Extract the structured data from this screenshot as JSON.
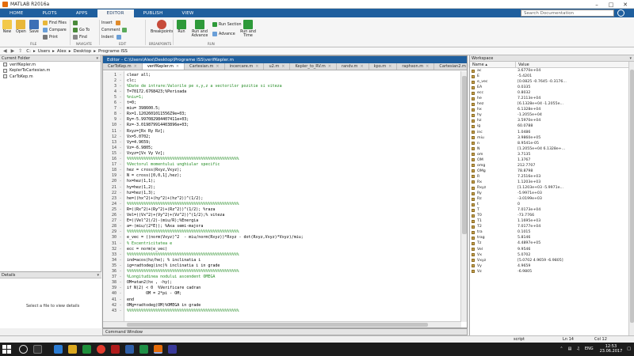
{
  "window": {
    "title": "MATLAB R2016a"
  },
  "ribbon_tabs": [
    "HOME",
    "PLOTS",
    "APPS",
    "EDITOR",
    "PUBLISH",
    "VIEW"
  ],
  "active_ribbon_tab": "EDITOR",
  "search": {
    "placeholder": "Search Documentation"
  },
  "ribbon": {
    "new": "New",
    "open": "Open",
    "save": "Save",
    "find_files": "Find Files",
    "compare": "Compare",
    "print": "Print",
    "go_to": "Go To",
    "find": "Find",
    "insert": "Insert",
    "comment": "Comment",
    "indent": "Indent",
    "breakpoints": "Breakpoints",
    "run": "Run",
    "run_and_advance": "Run and Advance",
    "run_section": "Run Section",
    "advance": "Advance",
    "run_and_time": "Run and Time",
    "groups": {
      "file": "FILE",
      "navigate": "NAVIGATE",
      "edit": "EDIT",
      "breakpoints": "BREAKPOINTS",
      "run": "RUN"
    }
  },
  "path": [
    "C:",
    "Users",
    "Alex",
    "Desktop",
    "Programe ISS"
  ],
  "current_folder": {
    "title": "Current Folder",
    "files": [
      "verifKepler.m",
      "KeplerToCartesian.m",
      "CarToKep.m"
    ]
  },
  "details": {
    "title": "Details",
    "message": "Select a file to view details"
  },
  "editor": {
    "title": "Editor - C:\\Users\\Alex\\Desktop\\Programe ISS\\verifKepler.m",
    "tabs": [
      "CarToKep.m",
      "verifKepler.m",
      "Cartesian.m",
      "incercare.m",
      "u2.m",
      "Kepler_to_RV.m",
      "randv.m",
      "kpo.m",
      "raphson.m",
      "Cartesian2.m",
      "sqrt.m"
    ],
    "active_tab": "verifKepler.m",
    "lines": [
      {
        "n": "1",
        "c": "clear all;",
        "t": "code"
      },
      {
        "n": "2",
        "c": "clc;",
        "t": "code"
      },
      {
        "n": "3",
        "c": "%Date de intrare:Valorile pe x,y,z a vectorilor pozitie si viteza",
        "t": "comment"
      },
      {
        "n": "4",
        "c": "T=70172.6768423;%Perioada",
        "t": "code"
      },
      {
        "n": "5",
        "c": "%niu=1;",
        "t": "comment"
      },
      {
        "n": "6",
        "c": "t=0;",
        "t": "code"
      },
      {
        "n": "7",
        "c": "miu= 398600.5;",
        "t": "code"
      },
      {
        "n": "8",
        "c": "Rx=1.1202601011556Z9e+03;",
        "t": "code"
      },
      {
        "n": "9",
        "c": "Ry=-5.997082984407411e+03;",
        "t": "code"
      },
      {
        "n": "10",
        "c": "Rz=-3.019879914403896e+03;",
        "t": "code"
      },
      {
        "n": "11",
        "c": "Rxyz=[Rx Ry Rz];",
        "t": "code"
      },
      {
        "n": "12",
        "c": "Vx=5.0702;",
        "t": "code"
      },
      {
        "n": "13",
        "c": "Vy=4.9659;",
        "t": "code"
      },
      {
        "n": "14",
        "c": "Vz=-6.9805;",
        "t": "code"
      },
      {
        "n": "15",
        "c": "Vxyz=[Vx Vy Vz];",
        "t": "code"
      },
      {
        "n": "16",
        "c": "%%%%%%%%%%%%%%%%%%%%%%%%%%%%%%%%%%%%%%%%%%%%%%%",
        "t": "comment"
      },
      {
        "n": "17",
        "c": "%Vectorul momentului unghiular specific",
        "t": "comment"
      },
      {
        "n": "18",
        "c": "hez = cross(Rxyz,Vxyz);",
        "t": "code"
      },
      {
        "n": "19",
        "c": "N = cross([0,0,1],hez);",
        "t": "code"
      },
      {
        "n": "20",
        "c": "hx=hez(1,1);",
        "t": "code"
      },
      {
        "n": "21",
        "c": "hy=hez(1,2);",
        "t": "code"
      },
      {
        "n": "22",
        "c": "hz=hez(1,3);",
        "t": "code"
      },
      {
        "n": "23",
        "c": "he=((hx^2)+(hy^2)+(hz^2))^(1/2);",
        "t": "code"
      },
      {
        "n": "24",
        "c": "%%%%%%%%%%%%%%%%%%%%%%%%%%%%%%%%%%%%%%%%%%%%%%%",
        "t": "comment"
      },
      {
        "n": "25",
        "c": "R=((Rx^2)+(Ry^2)+(Rz^2))^(1/2); %raza",
        "t": "code"
      },
      {
        "n": "26",
        "c": "Vel=((Vx^2)+(Vy^2)+(Vz^2))^(1/2);% viteza",
        "t": "code"
      },
      {
        "n": "27",
        "c": "E=((Vel^2)/2)-(miu/R);%Energia",
        "t": "code"
      },
      {
        "n": "28",
        "c": "a=-(miu/(2*E)); %Axa semi-majora",
        "t": "code"
      },
      {
        "n": "29",
        "c": "%%%%%%%%%%%%%%%%%%%%%%%%%%%%%%%%%%%%%%%%%%%%%%%",
        "t": "comment"
      },
      {
        "n": "30",
        "c": "e_vec = ((norm(Vxyz)^2  - miu/norm(Rxyz))*Rxyz - dot(Rxyz,Vxyz)*Vxyz)/miu;",
        "t": "code"
      },
      {
        "n": "31",
        "c": "% Excentricitatea e",
        "t": "comment"
      },
      {
        "n": "32",
        "c": "ecc = norm(e_vec)",
        "t": "code"
      },
      {
        "n": "33",
        "c": "%%%%%%%%%%%%%%%%%%%%%%%%%%%%%%%%%%%%%%%%%%%%%%%",
        "t": "comment"
      },
      {
        "n": "34",
        "c": "ind=acos(hz/he); % inclinatia i",
        "t": "code"
      },
      {
        "n": "35",
        "c": "ig=radtodeg(inc)% inclinatia i in grade",
        "t": "code"
      },
      {
        "n": "36",
        "c": "%%%%%%%%%%%%%%%%%%%%%%%%%%%%%%%%%%%%%%%%%%%%%%%",
        "t": "comment"
      },
      {
        "n": "37",
        "c": "%Longitudinea nodului ascendent OMEGA",
        "t": "comment"
      },
      {
        "n": "38",
        "c": "OM=atan2(hx , -hy);",
        "t": "code"
      },
      {
        "n": "39",
        "c": "if N(2) < 0  %Verificare cadran",
        "t": "code"
      },
      {
        "n": "40",
        "c": "        OM = 2*pi - OM;",
        "t": "code"
      },
      {
        "n": "41",
        "c": "end",
        "t": "code"
      },
      {
        "n": "42",
        "c": "OMg=radtodeg(OM)%OMEGA in grade",
        "t": "code"
      },
      {
        "n": "43",
        "c": "%%%%%%%%%%%%%%%%%%%%%%%%%%%%%%%%%%%%%%%%%%%%%%%",
        "t": "comment"
      }
    ]
  },
  "command_window": {
    "title": "Command Window"
  },
  "workspace": {
    "title": "Workspace",
    "headers": [
      "Name ▴",
      "Value"
    ],
    "vars": [
      {
        "name": "ac",
        "value": "3.6770e+04"
      },
      {
        "name": "E",
        "value": "-5.4201"
      },
      {
        "name": "e_vec",
        "value": "[0.0825 -0.7645 -0.3176..."
      },
      {
        "name": "EA",
        "value": "0.0335"
      },
      {
        "name": "ecc",
        "value": "0.8032"
      },
      {
        "name": "he",
        "value": "7.2113e+04"
      },
      {
        "name": "hez",
        "value": "[6.1328e+04 -1.2055e..."
      },
      {
        "name": "hx",
        "value": "6.1328e+04"
      },
      {
        "name": "hy",
        "value": "-1.2055e+04"
      },
      {
        "name": "hz",
        "value": "3.5970e+04"
      },
      {
        "name": "ig",
        "value": "60.0788"
      },
      {
        "name": "inc",
        "value": "1.0486"
      },
      {
        "name": "miu",
        "value": "3.9860e+05"
      },
      {
        "name": "n",
        "value": "8.9541e-05"
      },
      {
        "name": "N",
        "value": "[1.2055e+04 6.1328e+..."
      },
      {
        "name": "om",
        "value": "3.7135"
      },
      {
        "name": "OM",
        "value": "1.3767"
      },
      {
        "name": "omg",
        "value": "212.7707"
      },
      {
        "name": "OMg",
        "value": "78.8798"
      },
      {
        "name": "R",
        "value": "7.2516e+03"
      },
      {
        "name": "Rx",
        "value": "1.1203e+03"
      },
      {
        "name": "Rxyz",
        "value": "[1.1203e+03 -5.9971e..."
      },
      {
        "name": "Ry",
        "value": "-5.9971e+03"
      },
      {
        "name": "Rz",
        "value": "-3.0199e+03"
      },
      {
        "name": "t",
        "value": "0"
      },
      {
        "name": "T",
        "value": "7.0173e+04"
      },
      {
        "name": "T0",
        "value": "-73.7766"
      },
      {
        "name": "T1",
        "value": "1.1695e+03"
      },
      {
        "name": "T2",
        "value": "7.0177e+04"
      },
      {
        "name": "tra",
        "value": "0.1015"
      },
      {
        "name": "trag",
        "value": "5.8146"
      },
      {
        "name": "Tz",
        "value": "4.4897e+05"
      },
      {
        "name": "Vel",
        "value": "9.9546"
      },
      {
        "name": "Vx",
        "value": "5.0702"
      },
      {
        "name": "Vxyz",
        "value": "[5.0702 4.9659 -6.9805]"
      },
      {
        "name": "Vy",
        "value": "4.9659"
      },
      {
        "name": "Vz",
        "value": "-6.9805"
      }
    ]
  },
  "status": {
    "mode": "script",
    "ln_label": "Ln",
    "ln": "14",
    "col_label": "Col",
    "col": "12"
  },
  "taskbar": {
    "lang": "ENG",
    "time": "12:53",
    "date": "23.06.2017"
  },
  "colors": {
    "ribbon_blue": "#1f5f9e",
    "comment_green": "#228b22",
    "taskbar": "#1c1c1c"
  }
}
